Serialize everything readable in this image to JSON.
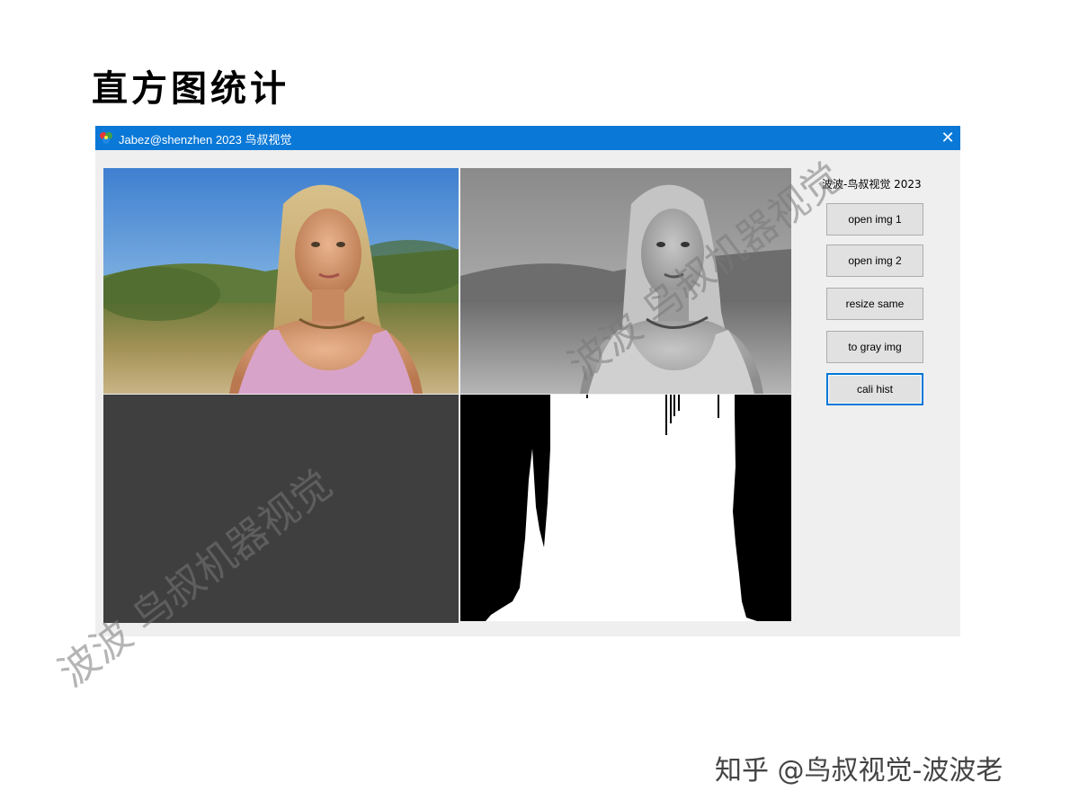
{
  "slide": {
    "title": "直方图统计"
  },
  "window": {
    "title": "Jabez@shenzhen 2023 鸟叔视觉",
    "close_label": "✕",
    "icon": "app-icon"
  },
  "side_panel": {
    "label": "波波-鸟叔视觉 2023",
    "buttons": [
      {
        "label": "open img 1"
      },
      {
        "label": "open img 2"
      },
      {
        "label": "resize same"
      },
      {
        "label": "to gray img"
      },
      {
        "label": "cali hist",
        "focused": true
      }
    ]
  },
  "panels": {
    "color_image": "portrait-color",
    "gray_image": "portrait-gray",
    "empty_panel": "dark-gray",
    "histogram": "gray-histogram"
  },
  "watermarks": {
    "lower_left": "波波  鸟叔机器视觉",
    "upper_right": "波波  鸟叔机器视觉"
  },
  "footer": {
    "credit": "知乎 @鸟叔视觉-波波老"
  },
  "colors": {
    "titlebar": "#0a78d7",
    "window_bg": "#efefef",
    "button_bg": "#e1e1e1",
    "focus_border": "#0078d7",
    "dark_panel": "#3f3f3f"
  }
}
